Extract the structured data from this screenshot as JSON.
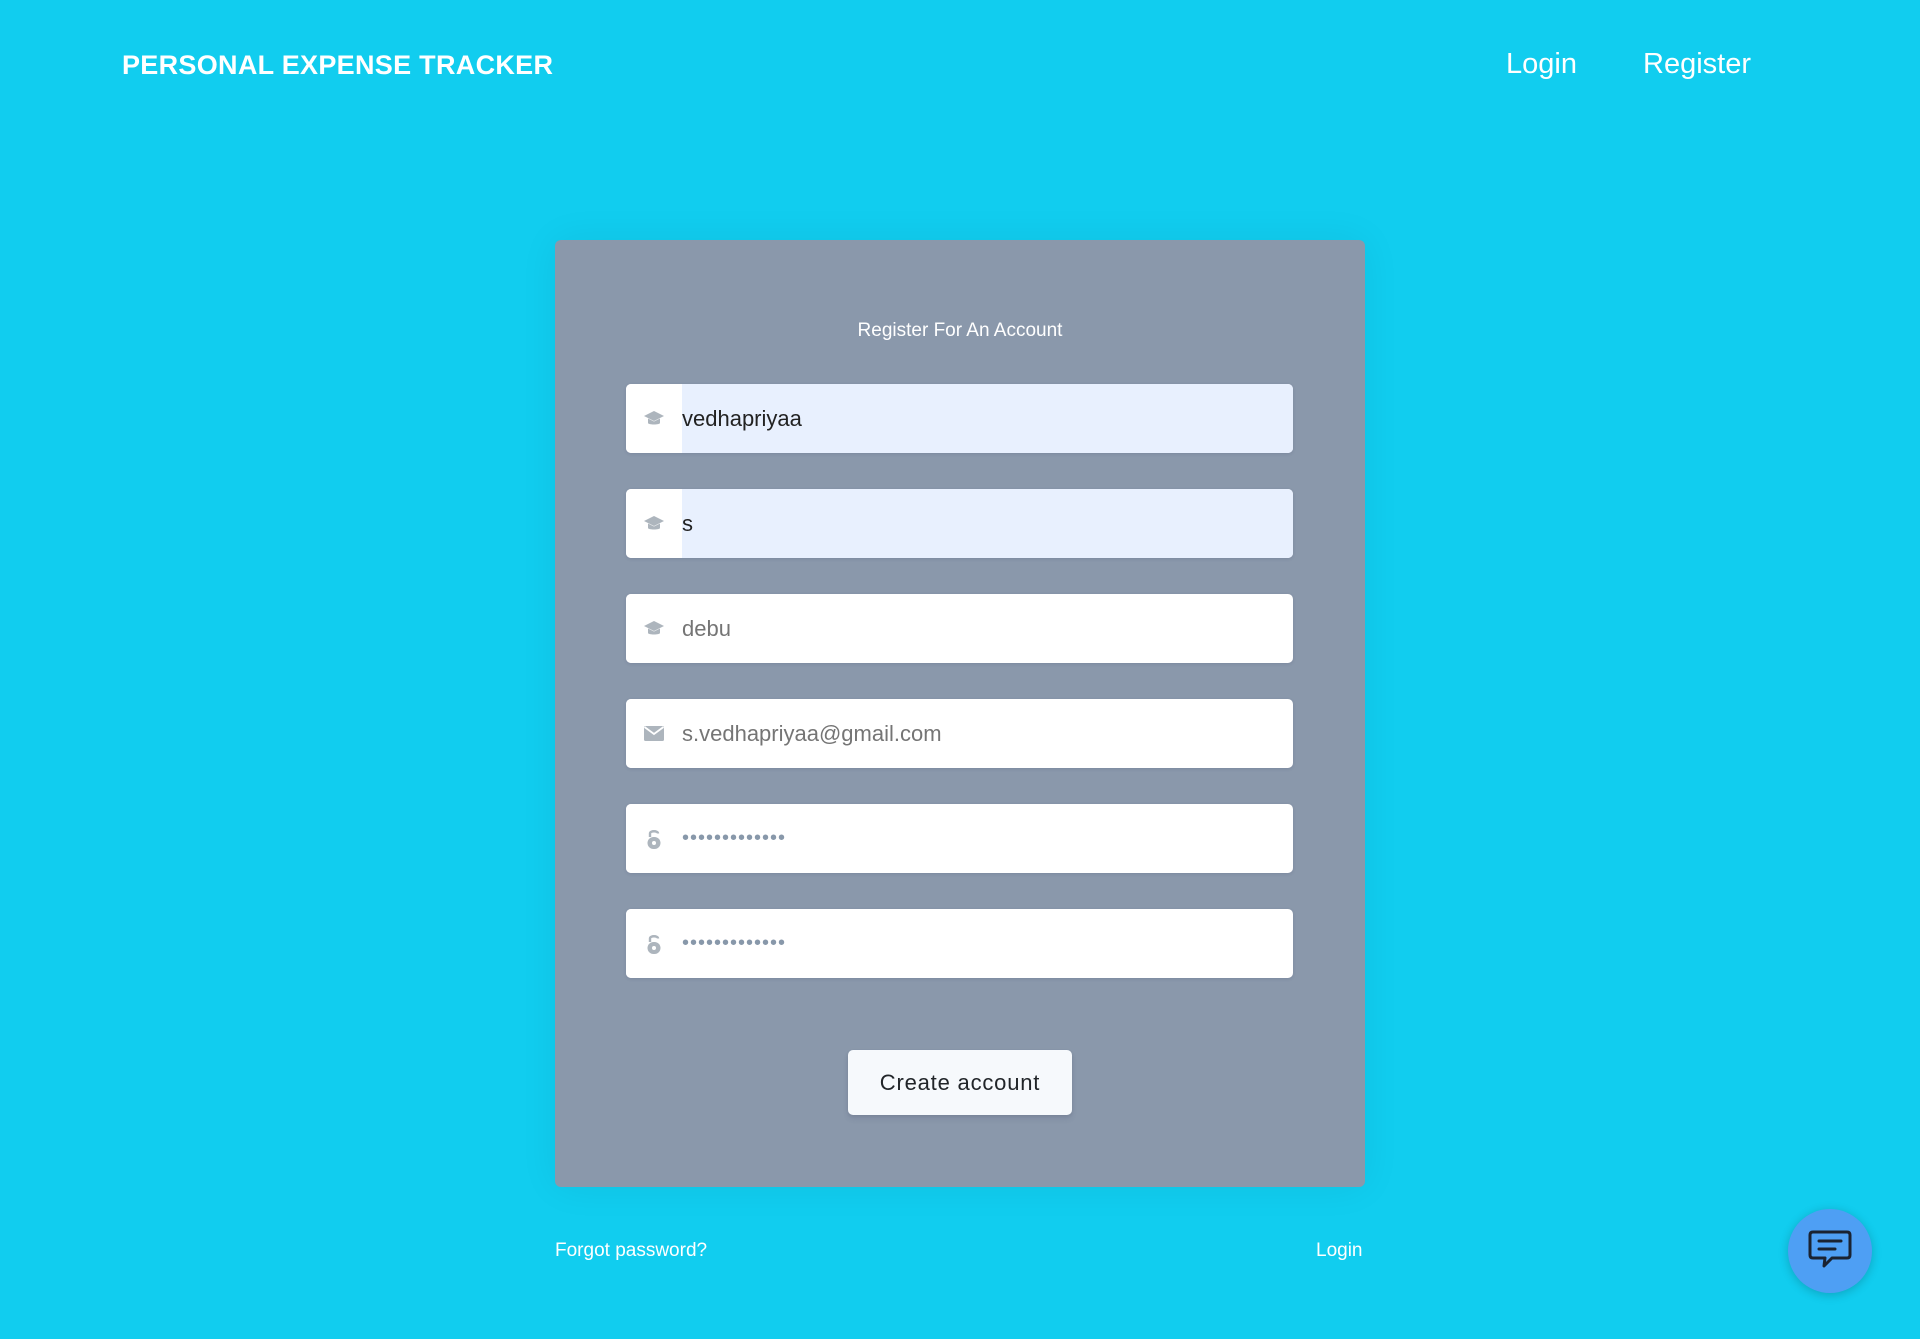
{
  "navbar": {
    "brand": "PERSONAL EXPENSE TRACKER",
    "links": [
      "Login",
      "Register"
    ]
  },
  "form": {
    "title": "Register For An Account",
    "fields": [
      {
        "icon": "graduation-cap-icon",
        "value": "vedhapriyaa",
        "autofilled": true
      },
      {
        "icon": "graduation-cap-icon",
        "value": "s",
        "autofilled": true
      },
      {
        "icon": "graduation-cap-icon",
        "placeholder": "debu"
      },
      {
        "icon": "envelope-icon",
        "placeholder": "s.vedhapriyaa@gmail.com"
      },
      {
        "icon": "lock-open-icon",
        "value": "•••••••••••••"
      },
      {
        "icon": "lock-open-icon",
        "value": "•••••••••••••"
      }
    ],
    "submit_label": "Create account"
  },
  "footer": {
    "forgot_password": "Forgot password?",
    "login": "Login"
  },
  "colors": {
    "background": "#11cdef",
    "card": "#8a98ab",
    "chat_button": "#4e9ff4"
  },
  "chat": {
    "icon": "chat-bubble-icon"
  }
}
